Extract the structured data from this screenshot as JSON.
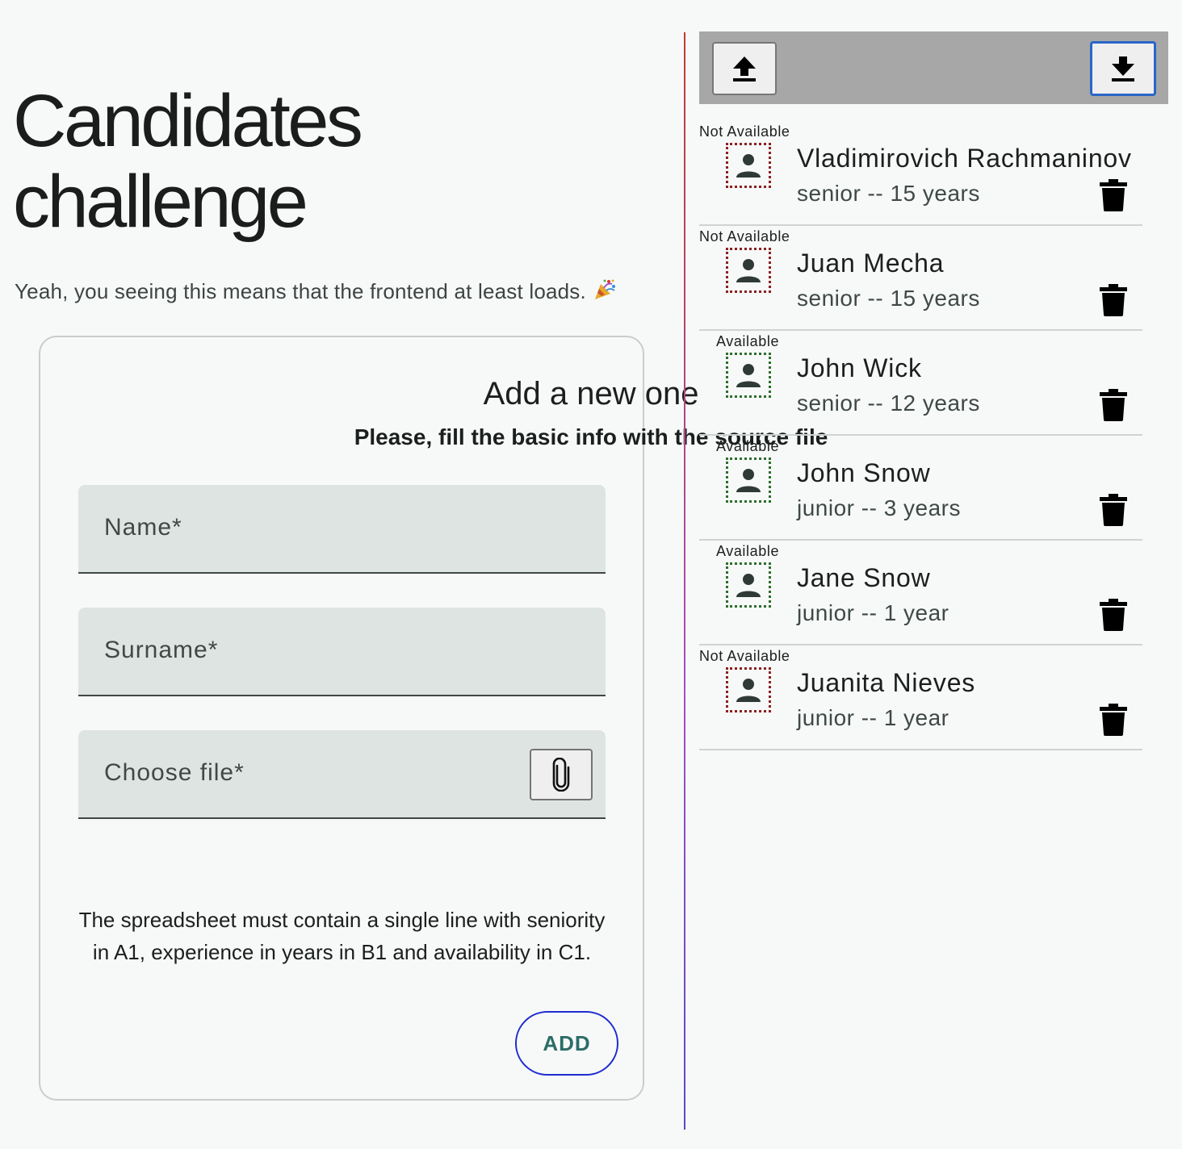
{
  "header": {
    "title_line1": "Candidates",
    "title_line2": "challenge",
    "subtitle": "Yeah, you seeing this means that the frontend at least loads."
  },
  "form": {
    "title": "Add a new one",
    "subtitle": "Please, fill the basic info with the source file",
    "name_placeholder": "Name*",
    "surname_placeholder": "Surname*",
    "file_placeholder": "Choose file*",
    "note": "The spreadsheet must contain a single line with seniority in A1, experience in years in B1 and availability in C1.",
    "add_label": "ADD"
  },
  "colors": {
    "available_border": "#2e6d2e",
    "not_available_border": "#8a2020",
    "toolbar_bg": "#a7a7a7",
    "add_button_border": "#1f2cd0",
    "add_button_text": "#2b6d68"
  },
  "toolbar": {
    "upload_icon": "upload-icon",
    "download_icon": "download-icon"
  },
  "candidates": [
    {
      "status": "Not Available",
      "available": false,
      "name": "Vladimirovich Rachmaninov",
      "meta": "senior -- 15 years"
    },
    {
      "status": "Not Available",
      "available": false,
      "name": "Juan Mecha",
      "meta": "senior -- 15 years"
    },
    {
      "status": "Available",
      "available": true,
      "name": "John Wick",
      "meta": "senior -- 12 years"
    },
    {
      "status": "Available",
      "available": true,
      "name": "John Snow",
      "meta": "junior -- 3 years"
    },
    {
      "status": "Available",
      "available": true,
      "name": "Jane Snow",
      "meta": "junior -- 1 year"
    },
    {
      "status": "Not Available",
      "available": false,
      "name": "Juanita Nieves",
      "meta": "junior -- 1 year"
    }
  ]
}
